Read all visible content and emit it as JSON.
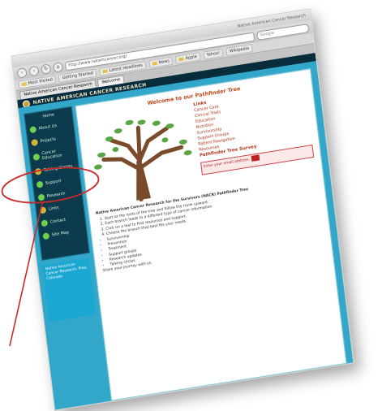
{
  "browser": {
    "window_title": "Native American Cancer Research",
    "search_placeholder": "Google",
    "url": "http://www.natamcancer.org/",
    "bookmarks": [
      "Most Visited",
      "Getting Started",
      "Latest Headlines",
      "News",
      "Apple",
      "Yahoo!",
      "Wikipedia"
    ],
    "tabs": [
      "Native American Cancer Research",
      "Welcome"
    ]
  },
  "site": {
    "header": "NATIVE AMERICAN CANCER RESEARCH",
    "sidebar_heading": "Home",
    "sidebar_items": [
      "About Us",
      "Projects",
      "Cancer Education",
      "Talking Circles",
      "Support",
      "Research",
      "Links",
      "Contact",
      "Site Map"
    ],
    "sidebar_info": "Native American Cancer Research, Pine, Colorado"
  },
  "content": {
    "welcome": "Welcome to our Pathfinder Tree",
    "right_heading": "Links",
    "right_links": [
      "Cancer Care",
      "Clinical Trials",
      "Education",
      "Nutrition",
      "Survivorship",
      "Support Groups",
      "Patient Navigation",
      "Resources"
    ],
    "right_heading2": "Pathfinder Tree Survey",
    "entry_hint": "Enter your email address",
    "intro": "Native American Cancer Research for the Survivors (NACR) Pathfinder Tree",
    "steps": [
      "Start at the roots of the tree and follow the trunk upward.",
      "Each branch leads to a different type of cancer information.",
      "Click on a leaf to find resources and support.",
      "Choose the branch that best fits your needs."
    ],
    "bullets": [
      "Survivorship",
      "Prevention",
      "Treatment",
      "Support groups",
      "Research updates",
      "Talking circles"
    ],
    "footer_line": "Share your journey with us."
  }
}
